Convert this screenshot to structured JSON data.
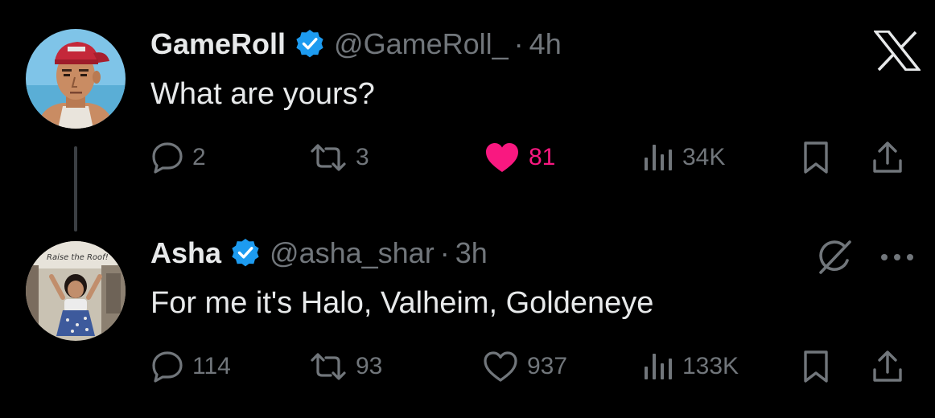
{
  "colors": {
    "background": "#000000",
    "primary_text": "#e7e9ea",
    "secondary_text": "#71767b",
    "verified_blue": "#1d9bf0",
    "like_active": "#f91880",
    "thread_line": "#3b3f43"
  },
  "tweets": [
    {
      "display_name": "GameRoll",
      "handle": "@GameRoll_",
      "separator": "·",
      "time": "4h",
      "text": "What are yours?",
      "verified": true,
      "actions": {
        "replies": "2",
        "reposts": "3",
        "likes": "81",
        "views": "34K"
      },
      "liked": true
    },
    {
      "display_name": "Asha",
      "handle": "@asha_shar",
      "separator": "·",
      "time": "3h",
      "text": "For me it's Halo, Valheim, Goldeneye",
      "verified": true,
      "avatar_sign": "Raise the Roof!",
      "actions": {
        "replies": "114",
        "reposts": "93",
        "likes": "937",
        "views": "133K"
      },
      "liked": false
    }
  ],
  "icons": {
    "logo": "x-logo-icon",
    "verified": "verified-badge-icon",
    "reply": "reply-icon",
    "repost": "repost-icon",
    "like": "heart-icon",
    "views": "views-icon",
    "bookmark": "bookmark-icon",
    "share": "share-icon",
    "grok": "grok-icon",
    "more": "more-icon"
  }
}
